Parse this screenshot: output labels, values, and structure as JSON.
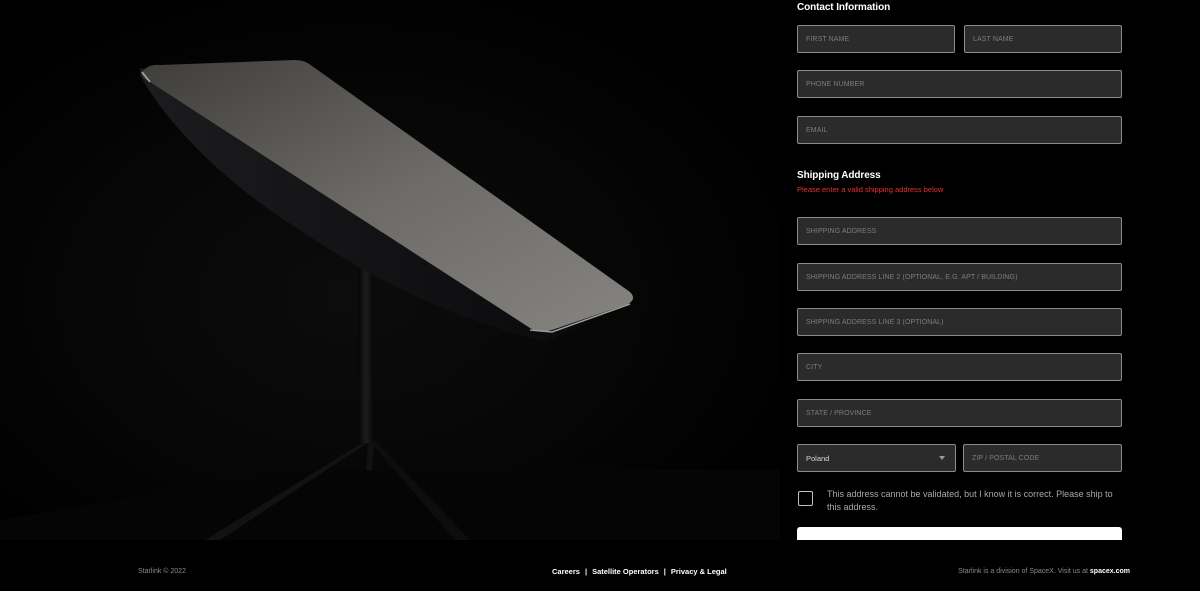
{
  "contact": {
    "title": "Contact Information",
    "first_name_placeholder": "FIRST NAME",
    "last_name_placeholder": "LAST NAME",
    "phone_placeholder": "PHONE NUMBER",
    "email_placeholder": "EMAIL"
  },
  "shipping": {
    "title": "Shipping Address",
    "error": "Please enter a valid shipping address below",
    "address_placeholder": "SHIPPING ADDRESS",
    "address2_placeholder": "SHIPPING ADDRESS LINE 2 (OPTIONAL, E.G. APT / BUILDING)",
    "address3_placeholder": "SHIPPING ADDRESS LINE 3 (OPTIONAL)",
    "city_placeholder": "CITY",
    "state_placeholder": "STATE / PROVINCE",
    "country_selected": "Poland",
    "zip_placeholder": "ZIP / POSTAL CODE",
    "confirm_label": "This address cannot be validated, but I know it is correct. Please ship to this address."
  },
  "footer": {
    "copyright": "Starlink © 2022",
    "links": [
      "Careers",
      "Satellite Operators",
      "Privacy & Legal"
    ],
    "separator": "|",
    "division_text": "Starlink is a division of SpaceX. Visit us at",
    "division_link": "spacex.com"
  },
  "colors": {
    "background": "#000000",
    "field_bg": "#2b2b2b",
    "field_border": "#8b8b8b",
    "error": "#e8322e"
  }
}
